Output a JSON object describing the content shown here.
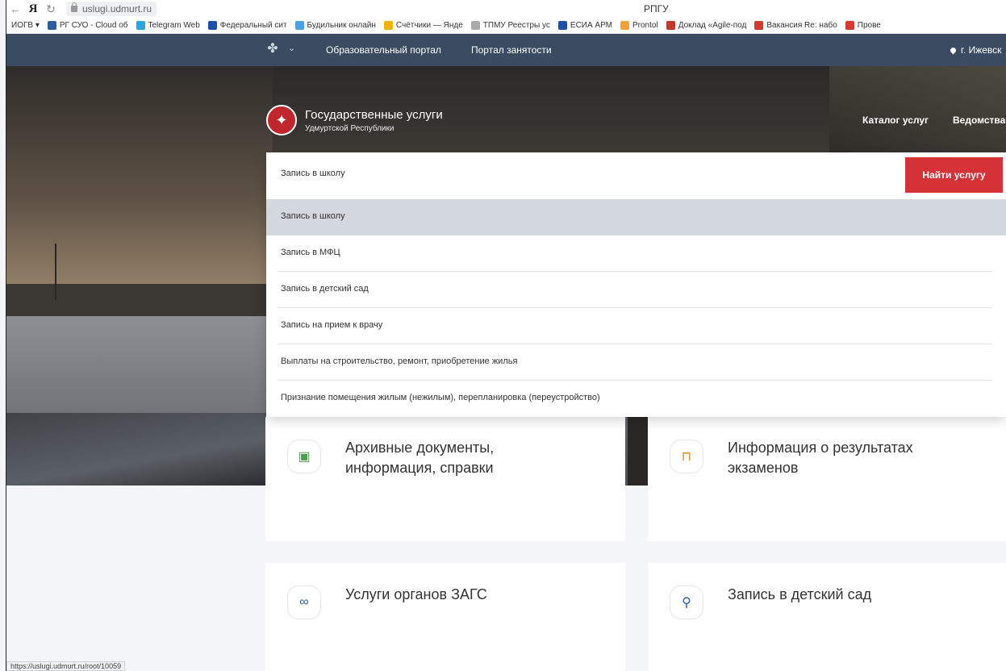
{
  "browser": {
    "url": "uslugi.udmurt.ru",
    "tab_title": "РПГУ",
    "bookmarks": [
      {
        "label": "ИОГВ ▾",
        "color": "#888888"
      },
      {
        "label": "РГ СУО - Cloud об",
        "color": "#2a5d9f"
      },
      {
        "label": "Telegram Web",
        "color": "#2aa3de"
      },
      {
        "label": "Федеральный сит",
        "color": "#1e4fa8"
      },
      {
        "label": "Будильник онлайн",
        "color": "#4aa0e8"
      },
      {
        "label": "Счётчики — Янде",
        "color": "#f2b400"
      },
      {
        "label": "ТПМУ Реестры ус",
        "color": "#aaaaaa"
      },
      {
        "label": "ЕСИА АРМ",
        "color": "#1e4fa8"
      },
      {
        "label": "Prontol",
        "color": "#f0a23b"
      },
      {
        "label": "Доклад «Agile-под",
        "color": "#c0392b"
      },
      {
        "label": "Вакансия Re: набо",
        "color": "#d03a2f"
      },
      {
        "label": "Прове",
        "color": "#d03a2f"
      }
    ]
  },
  "site_nav": {
    "portal1": "Образовательный портал",
    "portal2": "Портал занятости",
    "city": "г. Ижевск"
  },
  "hero": {
    "brand_title": "Государственные услуги",
    "brand_sub": "Удмуртской Республики",
    "menu1": "Каталог услуг",
    "menu2": "Ведомства"
  },
  "search": {
    "value": "Запись в школу",
    "button": "Найти услугу",
    "suggestions": [
      "Запись в школу",
      "Запись в МФЦ",
      "Запись в детский сад",
      "Запись на прием к врачу",
      "Выплаты на строительство, ремонт, приобретение жилья",
      "Признание помещения жилым (нежилым), перепланировка (переустройство)"
    ]
  },
  "cards": {
    "archive_l1": "Архивные документы,",
    "archive_l2": "информация, справки",
    "exams_l1": "Информация о результатах",
    "exams_l2": "экзаменов",
    "zags": "Услуги органов ЗАГС",
    "kindergarten": "Запись в детский сад"
  },
  "status_url": "https://uslugi.udmurt.ru/root/10059"
}
